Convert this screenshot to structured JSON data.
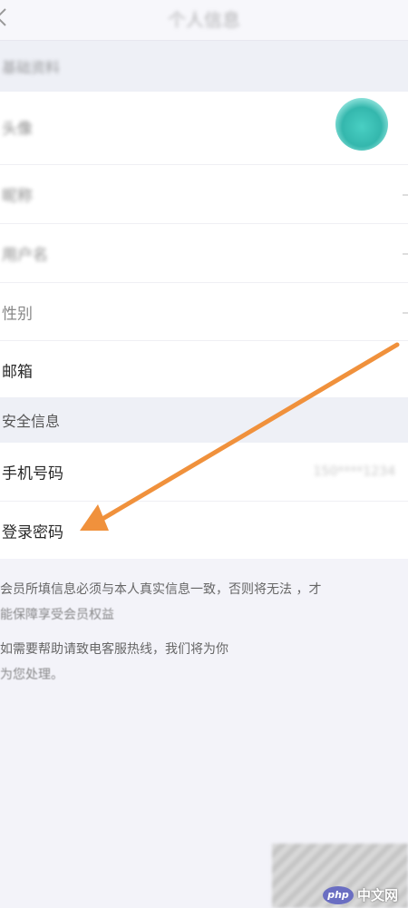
{
  "header": {
    "title": "个人信息"
  },
  "sections": {
    "basic_label": "基础资料",
    "security_label": "安全信息"
  },
  "basic_rows": [
    {
      "label": "头像"
    },
    {
      "label": "昵称"
    },
    {
      "label": "用户名"
    },
    {
      "label": "性别"
    },
    {
      "label": "邮箱"
    }
  ],
  "security_rows": [
    {
      "label": "手机号码",
      "value": "150****1234"
    },
    {
      "label": "登录密码"
    }
  ],
  "notices": {
    "line1a": "会员所填信息必须与本人真实信息一致，否则将无法 ，才",
    "line1b": "能保障享受会员权益",
    "line2a": "如需要帮助请致电客服热线，我们将为你",
    "line2b": "为您处理。"
  },
  "avatar": {
    "tag": "avatar"
  },
  "watermark": {
    "logo": "php",
    "text": "中文网"
  },
  "colors": {
    "arrow": "#f0913c",
    "avatar": "#3bbdb2"
  }
}
